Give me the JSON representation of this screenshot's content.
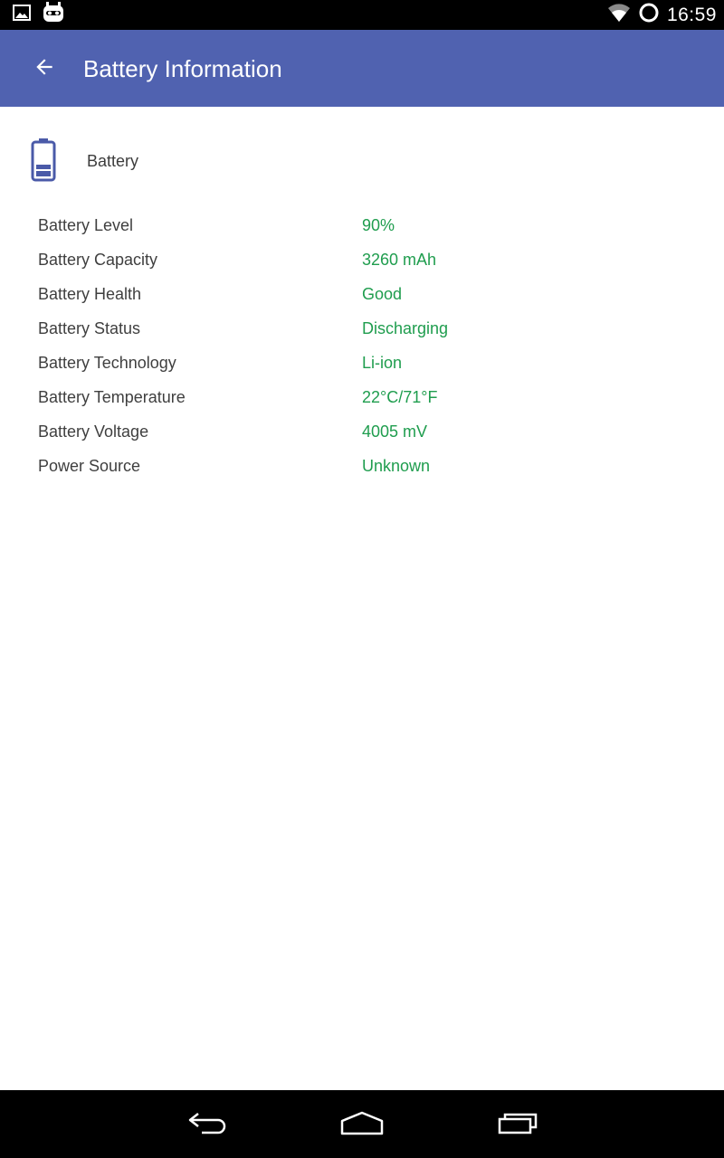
{
  "status_bar": {
    "time": "16:59",
    "icons": [
      "gallery-notification-icon",
      "cyanogen-notification-icon",
      "wifi-icon",
      "battery-ring-icon"
    ]
  },
  "toolbar": {
    "title": "Battery Information",
    "back_icon": "arrow-back-icon",
    "background_color": "#5062b0"
  },
  "section": {
    "title": "Battery",
    "icon": "battery-icon",
    "icon_color": "#4a5aa8"
  },
  "rows": [
    {
      "label": "Battery Level",
      "value": "90%"
    },
    {
      "label": "Battery Capacity",
      "value": "3260 mAh"
    },
    {
      "label": "Battery Health",
      "value": "Good"
    },
    {
      "label": "Battery Status",
      "value": "Discharging"
    },
    {
      "label": "Battery Technology",
      "value": "Li-ion"
    },
    {
      "label": "Battery Temperature",
      "value": "22°C/71°F"
    },
    {
      "label": "Battery Voltage",
      "value": "4005 mV"
    },
    {
      "label": "Power Source",
      "value": "Unknown"
    }
  ],
  "value_color": "#1f9d4e",
  "nav_bar": {
    "icons": [
      "back-icon",
      "home-icon",
      "recents-icon"
    ]
  }
}
